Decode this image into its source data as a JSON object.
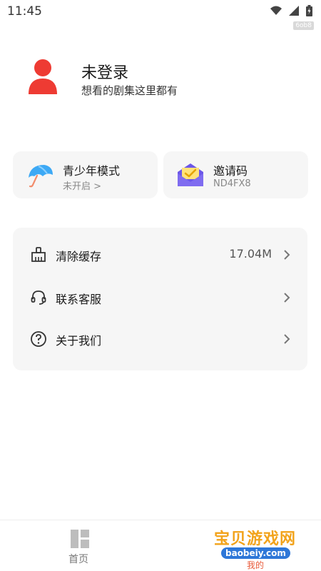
{
  "status_bar": {
    "time": "11:45",
    "badge": "6ob8"
  },
  "profile": {
    "title": "未登录",
    "subtitle": "想看的剧集这里都有",
    "avatar_color": "#ee3b33"
  },
  "cards": [
    {
      "title": "青少年模式",
      "subtitle": "未开启 >",
      "icon": "umbrella-icon"
    },
    {
      "title": "邀请码",
      "subtitle": "ND4FX8",
      "icon": "envelope-icon"
    }
  ],
  "menu": [
    {
      "label": "清除缓存",
      "value": "17.04M",
      "icon": "broom-icon"
    },
    {
      "label": "联系客服",
      "value": "",
      "icon": "headset-icon"
    },
    {
      "label": "关于我们",
      "value": "",
      "icon": "question-icon"
    }
  ],
  "bottom_nav": {
    "home_label": "首页",
    "mine_label": "我的",
    "watermark_text": "宝贝游戏网",
    "watermark_url": "baobeiy.com"
  },
  "colors": {
    "card_bg": "#f6f6f6",
    "avatar": "#ee3b33",
    "watermark": "#f2a31b"
  }
}
